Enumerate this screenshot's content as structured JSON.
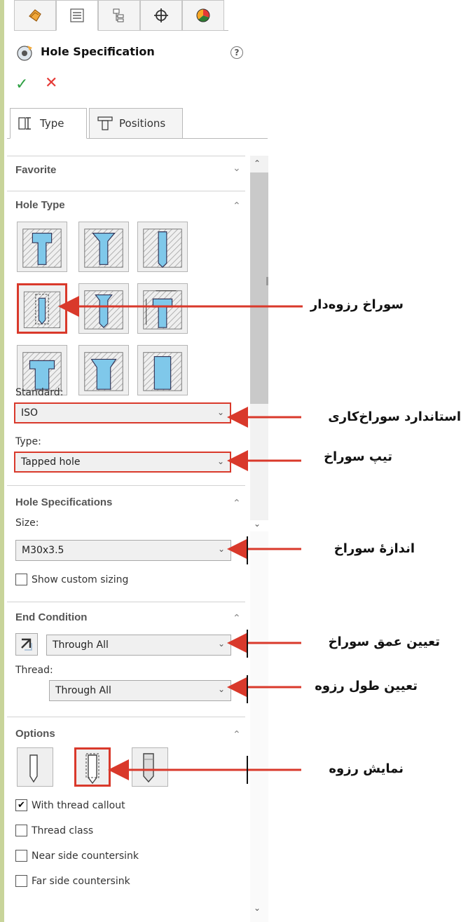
{
  "manager_tabs": [
    {
      "icon": "feature-manager-icon"
    },
    {
      "icon": "property-manager-icon"
    },
    {
      "icon": "configuration-manager-icon"
    },
    {
      "icon": "dimxpert-manager-icon"
    },
    {
      "icon": "display-manager-icon"
    }
  ],
  "header": {
    "title": "Hole Specification",
    "help": "?",
    "ok": "✓",
    "cancel": "✕"
  },
  "sub_tabs": [
    {
      "label": "Type",
      "icon": "type-tab-icon"
    },
    {
      "label": "Positions",
      "icon": "positions-tab-icon"
    }
  ],
  "sections": {
    "favorite": {
      "title": "Favorite"
    },
    "hole_type": {
      "title": "Hole Type",
      "selected_index": 3
    },
    "hole_specifications": {
      "title": "Hole Specifications"
    },
    "end_condition": {
      "title": "End Condition"
    },
    "options": {
      "title": "Options",
      "selected_index": 1
    }
  },
  "fields": {
    "standard_label": "Standard:",
    "standard_value": "ISO",
    "type_label": "Type:",
    "type_value": "Tapped hole",
    "size_label": "Size:",
    "size_value": "M30x3.5",
    "show_custom_sizing": "Show custom sizing",
    "end_condition_value": "Through All",
    "thread_label": "Thread:",
    "thread_value": "Through All"
  },
  "checkboxes": [
    {
      "label": "With thread callout",
      "checked": true
    },
    {
      "label": "Thread class",
      "checked": false
    },
    {
      "label": "Near side countersink",
      "checked": false
    },
    {
      "label": "Far side countersink",
      "checked": false
    }
  ],
  "annotations": {
    "tapped_hole": "سوراخ رزوه‌دار",
    "hole_standard": "استاندارد سوراخ‌کاری",
    "hole_type": "تیپ سوراخ",
    "hole_size": "اندازهٔ سوراخ",
    "hole_depth": "تعیین عمق سوراخ",
    "thread_length": "تعیین طول رزوه",
    "thread_display": "نمایش رزوه"
  },
  "colors": {
    "highlight": "#d9392b",
    "ok": "#2ea043",
    "cancel": "#e53935",
    "hole_blue": "#7fc8ea"
  }
}
